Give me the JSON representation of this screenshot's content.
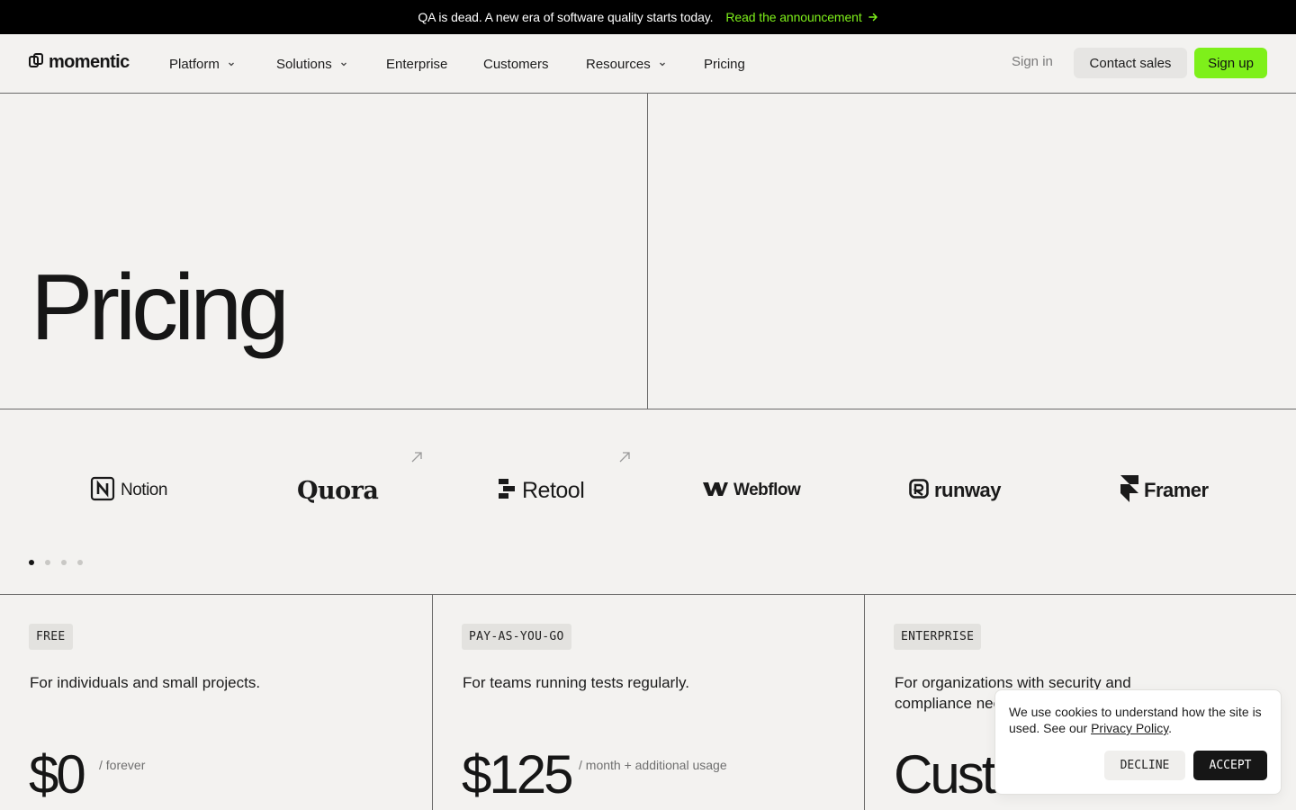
{
  "announcement": {
    "text": "QA is dead. A new era of software quality starts today.",
    "link_label": "Read the announcement",
    "link_icon": "arrow-right-icon",
    "accent_color": "#7ef01a"
  },
  "nav": {
    "logo_text": "momentic",
    "logo_icon": "momentic-logo-icon",
    "items": [
      {
        "label": "Platform",
        "has_dropdown": true
      },
      {
        "label": "Solutions",
        "has_dropdown": true
      },
      {
        "label": "Enterprise",
        "has_dropdown": false
      },
      {
        "label": "Customers",
        "has_dropdown": false
      },
      {
        "label": "Resources",
        "has_dropdown": true
      },
      {
        "label": "Pricing",
        "has_dropdown": false
      }
    ],
    "sign_in": "Sign in",
    "contact_sales": "Contact sales",
    "sign_up": "Sign up",
    "sign_up_color": "#7ef01a"
  },
  "hero": {
    "title": "Pricing"
  },
  "customer_logos": {
    "items": [
      {
        "name": "Notion",
        "icon": "notion-logo-icon",
        "external": false
      },
      {
        "name": "Quora",
        "icon": "quora-logo-icon",
        "external": true
      },
      {
        "name": "Retool",
        "icon": "retool-logo-icon",
        "external": true
      },
      {
        "name": "Webflow",
        "icon": "webflow-logo-icon",
        "external": false
      },
      {
        "name": "runway",
        "icon": "runway-logo-icon",
        "external": false
      },
      {
        "name": "Framer",
        "icon": "framer-logo-icon",
        "external": false
      }
    ],
    "carousel_pages": 4,
    "active_page": 1
  },
  "plans": [
    {
      "tag": "FREE",
      "description": "For individuals and small projects.",
      "price": "$0",
      "unit": "/ forever"
    },
    {
      "tag": "PAY-AS-YOU-GO",
      "description": "For teams running tests regularly.",
      "price": "$125",
      "unit": "/ month + additional usage"
    },
    {
      "tag": "ENTERPRISE",
      "description": "For organizations with security and compliance needs.",
      "price": "Custom",
      "unit": ""
    }
  ],
  "cookie": {
    "text": "We use cookies to understand how the site is used. See our ",
    "link": "Privacy Policy",
    "suffix": ".",
    "decline": "DECLINE",
    "accept": "ACCEPT"
  }
}
